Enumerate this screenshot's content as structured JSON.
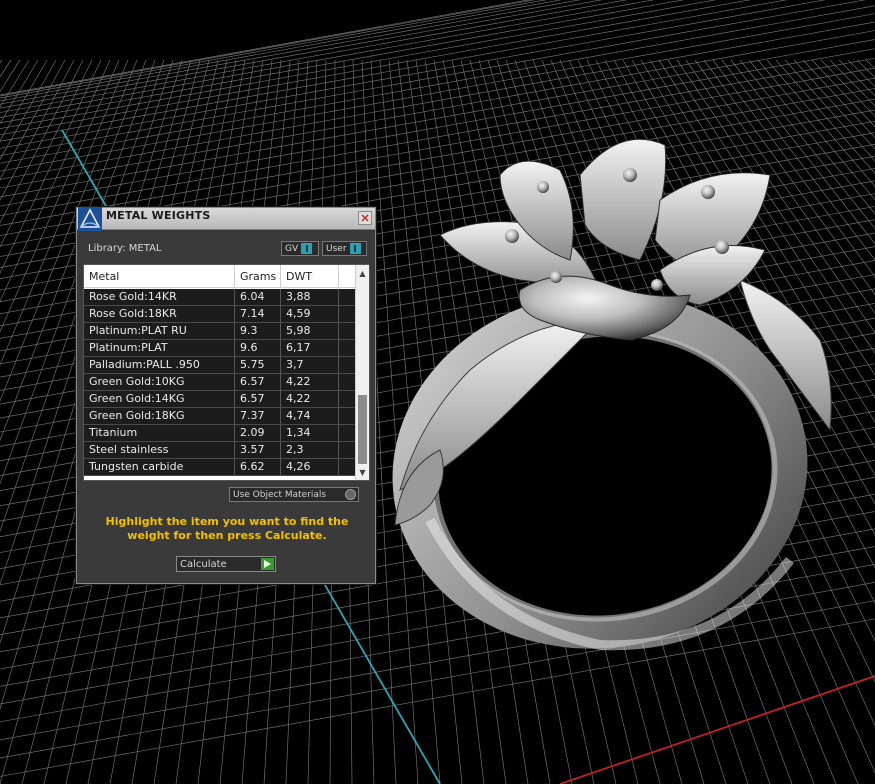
{
  "dialog": {
    "title": "METAL WEIGHTS",
    "library_label": "Library: METAL",
    "toggle_gv": "GV",
    "toggle_user": "User",
    "use_object_materials": "Use Object Materials",
    "hint": "Highlight the item you want to find the weight for then press Calculate.",
    "calculate_label": "Calculate",
    "colors": {
      "hint": "#f2c200",
      "accent": "#2f9fb0",
      "go": "#3a9a30"
    }
  },
  "table": {
    "headers": [
      "Metal",
      "Grams",
      "DWT"
    ],
    "rows": [
      [
        "Rose Gold:14KR",
        "6.04",
        "3,88"
      ],
      [
        "Rose Gold:18KR",
        "7.14",
        "4,59"
      ],
      [
        "Platinum:PLAT RU",
        "9.3",
        "5,98"
      ],
      [
        "Platinum:PLAT",
        "9.6",
        "6,17"
      ],
      [
        "Palladium:PALL .950",
        "5.75",
        "3,7"
      ],
      [
        "Green Gold:10KG",
        "6.57",
        "4,22"
      ],
      [
        "Green Gold:14KG",
        "6.57",
        "4,22"
      ],
      [
        "Green Gold:18KG",
        "7.37",
        "4,74"
      ],
      [
        "Titanium",
        "2.09",
        "1,34"
      ],
      [
        "Steel stainless",
        "3.57",
        "2,3"
      ],
      [
        "Tungsten carbide",
        "6.62",
        "4,26"
      ]
    ]
  },
  "viewport": {
    "background": "#000000",
    "grid_color": "#7a7a7a",
    "axis_y_color": "#2aa7b8",
    "axis_x_color": "#c0202a",
    "object": "ring-model"
  }
}
